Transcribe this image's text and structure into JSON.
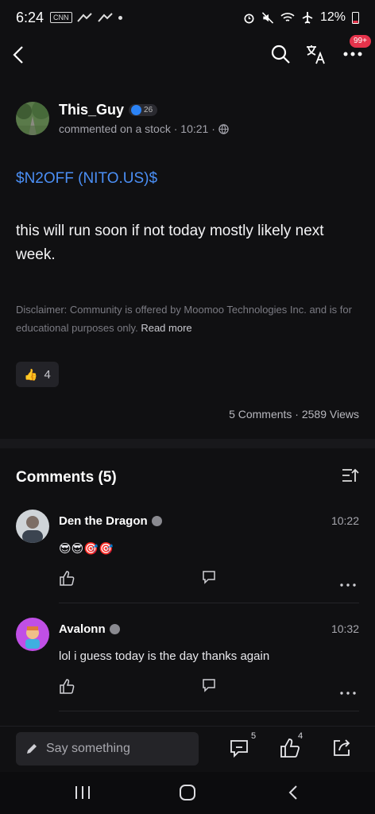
{
  "status_bar": {
    "time": "6:24",
    "battery": "12%",
    "left_icons": [
      "cnn-icon",
      "bird-icon",
      "bird-icon",
      "dot-icon"
    ],
    "right_icons": [
      "alarm-icon",
      "mute-icon",
      "wifi-icon",
      "airplane-icon",
      "battery-icon"
    ]
  },
  "header": {
    "notification_badge": "99+"
  },
  "post": {
    "author": "This_Guy",
    "level": "26",
    "meta": "commented on a stock · 10:21 ·",
    "ticker": "$N2OFF (NITO.US)$",
    "body": "this will run soon if not today mostly likely next week.",
    "disclaimer": "Disclaimer: Community is offered by Moomoo Technologies Inc. and is for educational purposes only.",
    "read_more": "Read more",
    "likes": "4",
    "stats": "5 Comments · 2589 Views"
  },
  "comments": {
    "title": "Comments (5)",
    "items": [
      {
        "name": "Den the Dragon",
        "time": "10:22",
        "text": "😎😎🎯🎯"
      },
      {
        "name": "Avalonn",
        "time": "10:32",
        "text": "lol i guess today is the day thanks again"
      }
    ]
  },
  "bottom": {
    "placeholder": "Say something",
    "comment_count": "5",
    "like_count": "4"
  },
  "colors": {
    "background": "#101012",
    "accent_blue": "#4b8ff5",
    "badge_red": "#e5334b"
  }
}
